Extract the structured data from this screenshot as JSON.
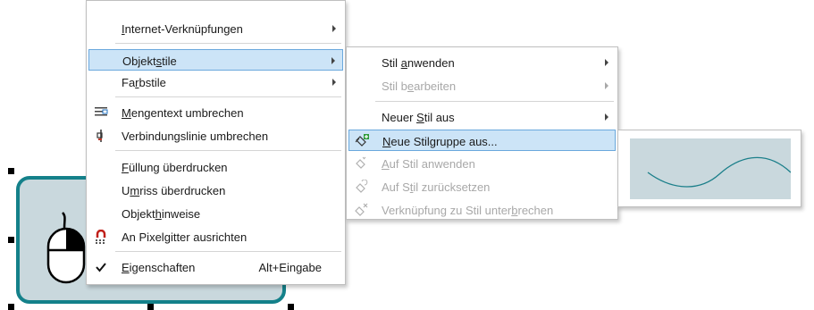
{
  "main_menu": {
    "items": [
      {
        "pre": "",
        "acc": "I",
        "post": "nternet-Verknüpfungen",
        "submenu": true
      },
      {
        "pre": "Objekt",
        "acc": "s",
        "post": "tile",
        "submenu": true,
        "highlighted": true
      },
      {
        "pre": "Fa",
        "acc": "r",
        "post": "bstile",
        "submenu": true
      },
      {
        "pre": "",
        "acc": "M",
        "post": "engentext umbrechen",
        "icon": "text-wrap-icon"
      },
      {
        "pre": "",
        "acc": "",
        "post": "Verbindungslinie umbrechen",
        "icon": "connector-wrap-icon"
      },
      {
        "pre": "",
        "acc": "F",
        "post": "üllung überdrucken"
      },
      {
        "pre": "U",
        "acc": "m",
        "post": "riss überdrucken"
      },
      {
        "pre": "Objekt",
        "acc": "h",
        "post": "inweise"
      },
      {
        "pre": "An Pixel",
        "acc": "g",
        "post": "itter ausrichten",
        "icon": "pixel-grid-snap-icon"
      },
      {
        "pre": "",
        "acc": "E",
        "post": "igenschaften",
        "icon": "checkmark-icon",
        "shortcut": "Alt+Eingabe"
      }
    ]
  },
  "sub_menu": {
    "items": [
      {
        "pre": "Stil ",
        "acc": "a",
        "post": "nwenden",
        "submenu": true
      },
      {
        "pre": "Stil b",
        "acc": "e",
        "post": "arbeiten",
        "submenu": true,
        "disabled": true
      },
      {
        "pre": "Neuer ",
        "acc": "S",
        "post": "til aus",
        "submenu": true
      },
      {
        "pre": "",
        "acc": "N",
        "post": "eue Stilgruppe aus...",
        "icon": "new-style-group-icon",
        "highlighted": true
      },
      {
        "pre": "",
        "acc": "A",
        "post": "uf Stil anwenden",
        "icon": "apply-to-style-icon",
        "disabled": true
      },
      {
        "pre": "Auf S",
        "acc": "t",
        "post": "il zurücksetzen",
        "icon": "revert-to-style-icon",
        "disabled": true
      },
      {
        "pre": "Verknüpfung zu Stil unter",
        "acc": "b",
        "post": "rechen",
        "icon": "break-link-to-style-icon",
        "disabled": true
      }
    ]
  },
  "colors": {
    "canvas_fill": "#c9d8dd",
    "canvas_outline": "#14818a",
    "highlight": "#cce4f7",
    "preview_curve": "#1b7f8a"
  }
}
